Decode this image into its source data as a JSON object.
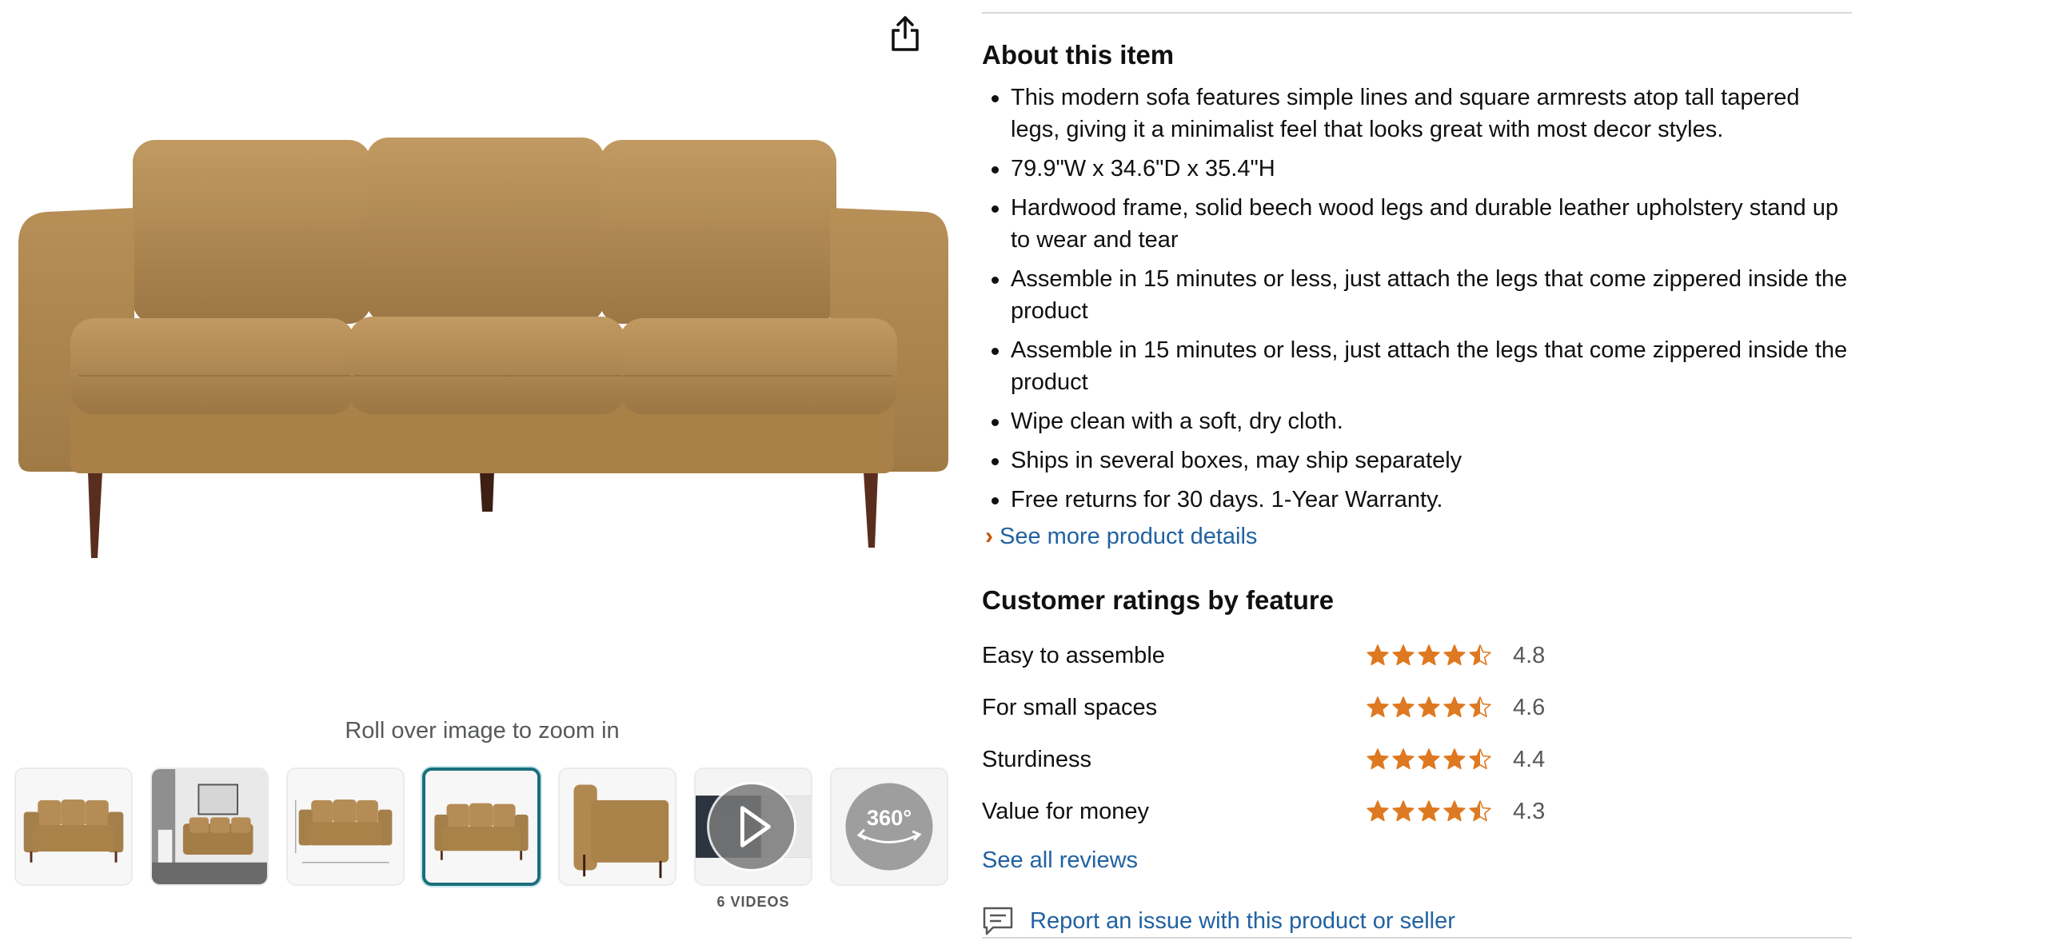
{
  "gallery": {
    "zoom_hint": "Roll over image to zoom in",
    "videos_label": "6 VIDEOS",
    "thumbnails": [
      {
        "name": "thumb-front-view"
      },
      {
        "name": "thumb-room-scene"
      },
      {
        "name": "thumb-dimensions"
      },
      {
        "name": "thumb-front-view-selected",
        "selected": true
      },
      {
        "name": "thumb-side-view"
      },
      {
        "name": "thumb-videos"
      },
      {
        "name": "thumb-360-view",
        "text": "360°"
      }
    ]
  },
  "about": {
    "title": "About this item",
    "bullets": [
      "This modern sofa features simple lines and square armrests atop tall tapered legs, giving it a minimalist feel that looks great with most decor styles.",
      "79.9\"W x 34.6\"D x 35.4\"H",
      "Hardwood frame, solid beech wood legs and durable leather upholstery stand up to wear and tear",
      "Assemble in 15 minutes or less, just attach the legs that come zippered inside the product",
      "Assemble in 15 minutes or less, just attach the legs that come zippered inside the product",
      "Wipe clean with a soft, dry cloth.",
      "Ships in several boxes, may ship separately",
      "Free returns for 30 days. 1-Year Warranty."
    ],
    "see_more": "See more product details"
  },
  "ratings": {
    "title": "Customer ratings by feature",
    "items": [
      {
        "label": "Easy to assemble",
        "value": "4.8",
        "stars": 4.5
      },
      {
        "label": "For small spaces",
        "value": "4.6",
        "stars": 4.5
      },
      {
        "label": "Sturdiness",
        "value": "4.4",
        "stars": 4.5
      },
      {
        "label": "Value for money",
        "value": "4.3",
        "stars": 4.5
      }
    ],
    "see_all": "See all reviews"
  },
  "report": {
    "label": "Report an issue with this product or seller"
  },
  "colors": {
    "link": "#2162a1",
    "star": "#de7921",
    "selected_border": "#1b6f7c",
    "sofa": "#b08a54"
  }
}
